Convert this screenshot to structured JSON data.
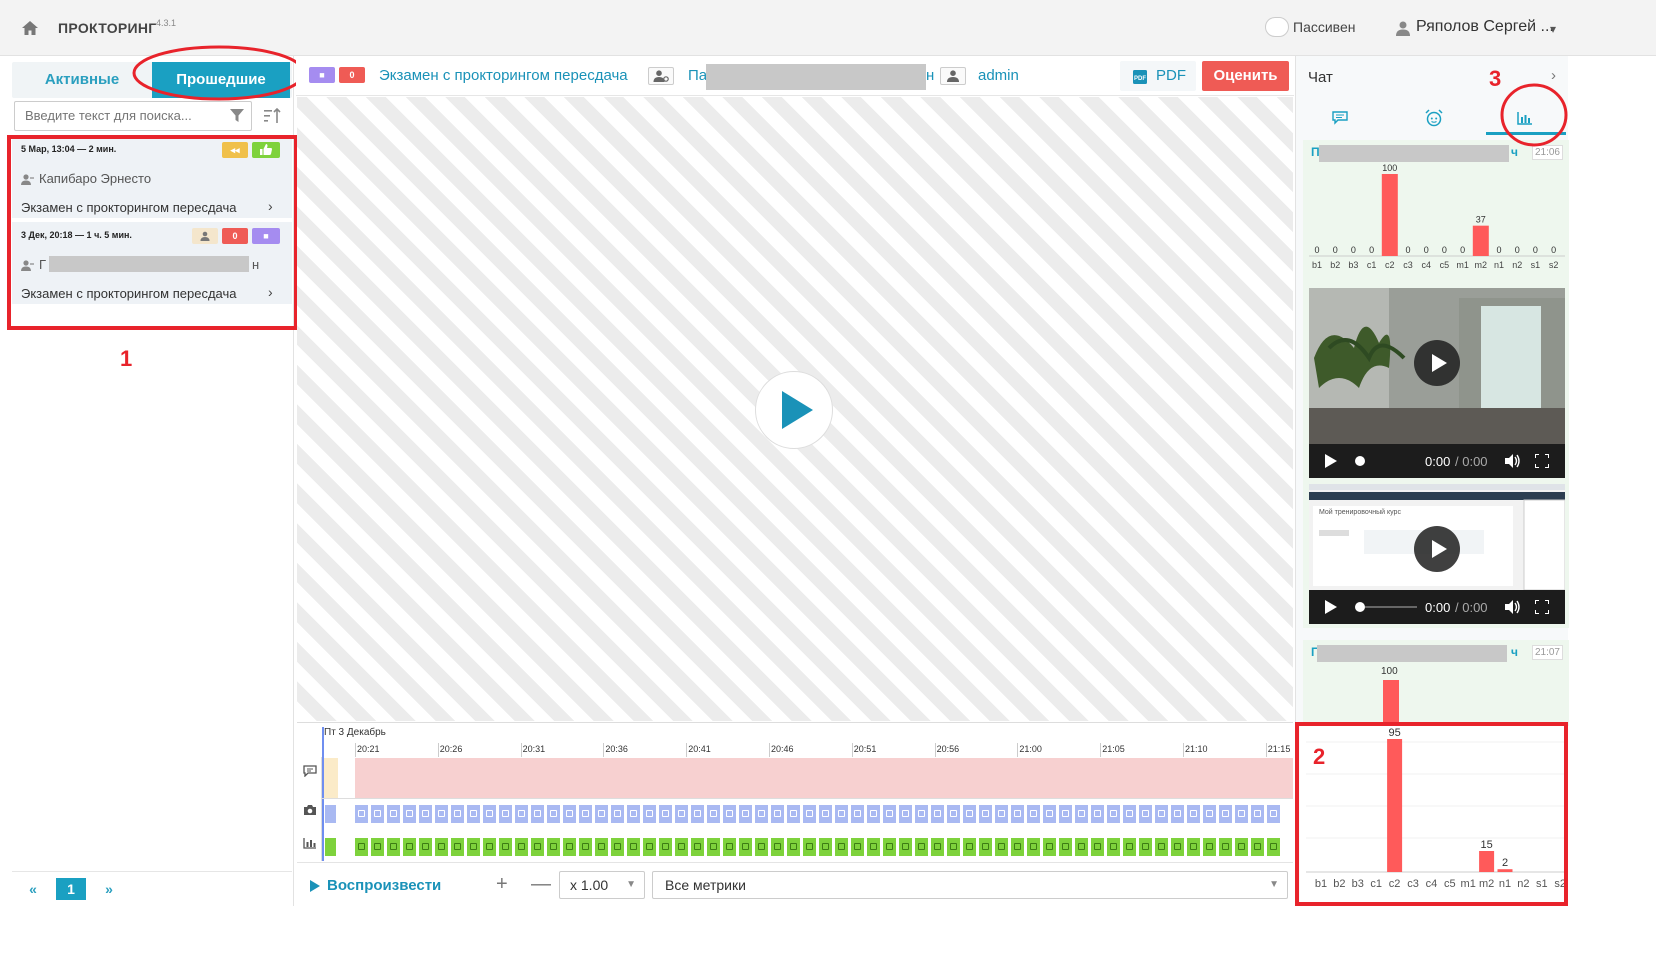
{
  "header": {
    "app_title": "ПРОКТОРИНГ",
    "version": "4.3.1",
    "status_label": "Пассивен",
    "user_name": "Ряполов Сергей ..."
  },
  "left_panel": {
    "tabs": [
      {
        "label": "Активные",
        "active": false
      },
      {
        "label": "Прошедшие",
        "active": true
      }
    ],
    "search_placeholder": "Введите текст для поиска...",
    "sessions": [
      {
        "datetime": "5 Мар, 13:04 — 2 мин.",
        "student": "Капибаро Эрнесто",
        "exam": "Экзамен с прокторингом пересдача",
        "badges": [
          {
            "text": "◂◂",
            "color": "#f0c04a"
          },
          {
            "text": "👍",
            "color": "#7ed23c"
          }
        ]
      },
      {
        "datetime": "3 Дек, 20:18 — 1 ч. 5 мин.",
        "student": "Г",
        "student_suffix": "н",
        "exam": "Экзамен с прокторингом пересдача",
        "badges": [
          {
            "text": "",
            "color": "#f4e6cc"
          },
          {
            "text": "0",
            "color": "#ef5b55"
          },
          {
            "text": "■",
            "color": "#a58cf0"
          }
        ]
      }
    ],
    "pager": {
      "first": "«",
      "current": "1",
      "next": "»"
    }
  },
  "annotations": {
    "a1": "1",
    "a2": "2",
    "a3": "3"
  },
  "toolbar": {
    "badge_a": "■",
    "badge_b": "0",
    "exam_title": "Экзамен с прокторингом пересдача",
    "student_prefix": "Па",
    "student_suffix": "н",
    "proctor": "admin",
    "pdf_label": "PDF",
    "rate_label": "Оценить"
  },
  "timeline": {
    "date_label": "Пт 3 Декабрь",
    "ticks": [
      "20:21",
      "20:26",
      "20:31",
      "20:36",
      "20:41",
      "20:46",
      "20:51",
      "20:56",
      "21:00",
      "21:05",
      "21:10",
      "21:15"
    ]
  },
  "controls": {
    "play_label": "Воспроизвести",
    "speed": "x 1.00",
    "metrics": "Все метрики"
  },
  "right_panel": {
    "title": "Чат",
    "messages": [
      {
        "name_prefix": "П",
        "name_suffix": "ч",
        "time": "21:06"
      },
      {
        "name_prefix": "П",
        "name_suffix": "ч",
        "time": "21:07"
      }
    ],
    "video_time": "0:00",
    "video_duration": "/ 0:00",
    "screen_caption": "Мой тренировочный курс"
  },
  "chart_data": [
    {
      "type": "bar",
      "categories": [
        "b1",
        "b2",
        "b3",
        "c1",
        "c2",
        "c3",
        "c4",
        "c5",
        "m1",
        "m2",
        "n1",
        "n2",
        "s1",
        "s2"
      ],
      "values": [
        0,
        0,
        0,
        0,
        100,
        0,
        0,
        0,
        0,
        37,
        0,
        0,
        0,
        0
      ],
      "ylim": [
        0,
        100
      ]
    },
    {
      "type": "bar",
      "categories": [
        "b1",
        "b2",
        "b3",
        "c1",
        "c2",
        "c3",
        "c4",
        "c5",
        "m1",
        "m2",
        "n1",
        "n2",
        "s1",
        "s2"
      ],
      "values": [
        null,
        null,
        null,
        null,
        95,
        null,
        null,
        null,
        null,
        15,
        2,
        null,
        null,
        null
      ],
      "ylim": [
        0,
        100
      ]
    }
  ],
  "colors": {
    "accent": "#1aa0c2",
    "danger": "#ef5b55",
    "bar": "#ff5a5a",
    "annotation": "#e8232b",
    "timeline_red": "#f7d0d0",
    "timeline_blue": "#a9b9f2",
    "timeline_green": "#7ed23c"
  }
}
